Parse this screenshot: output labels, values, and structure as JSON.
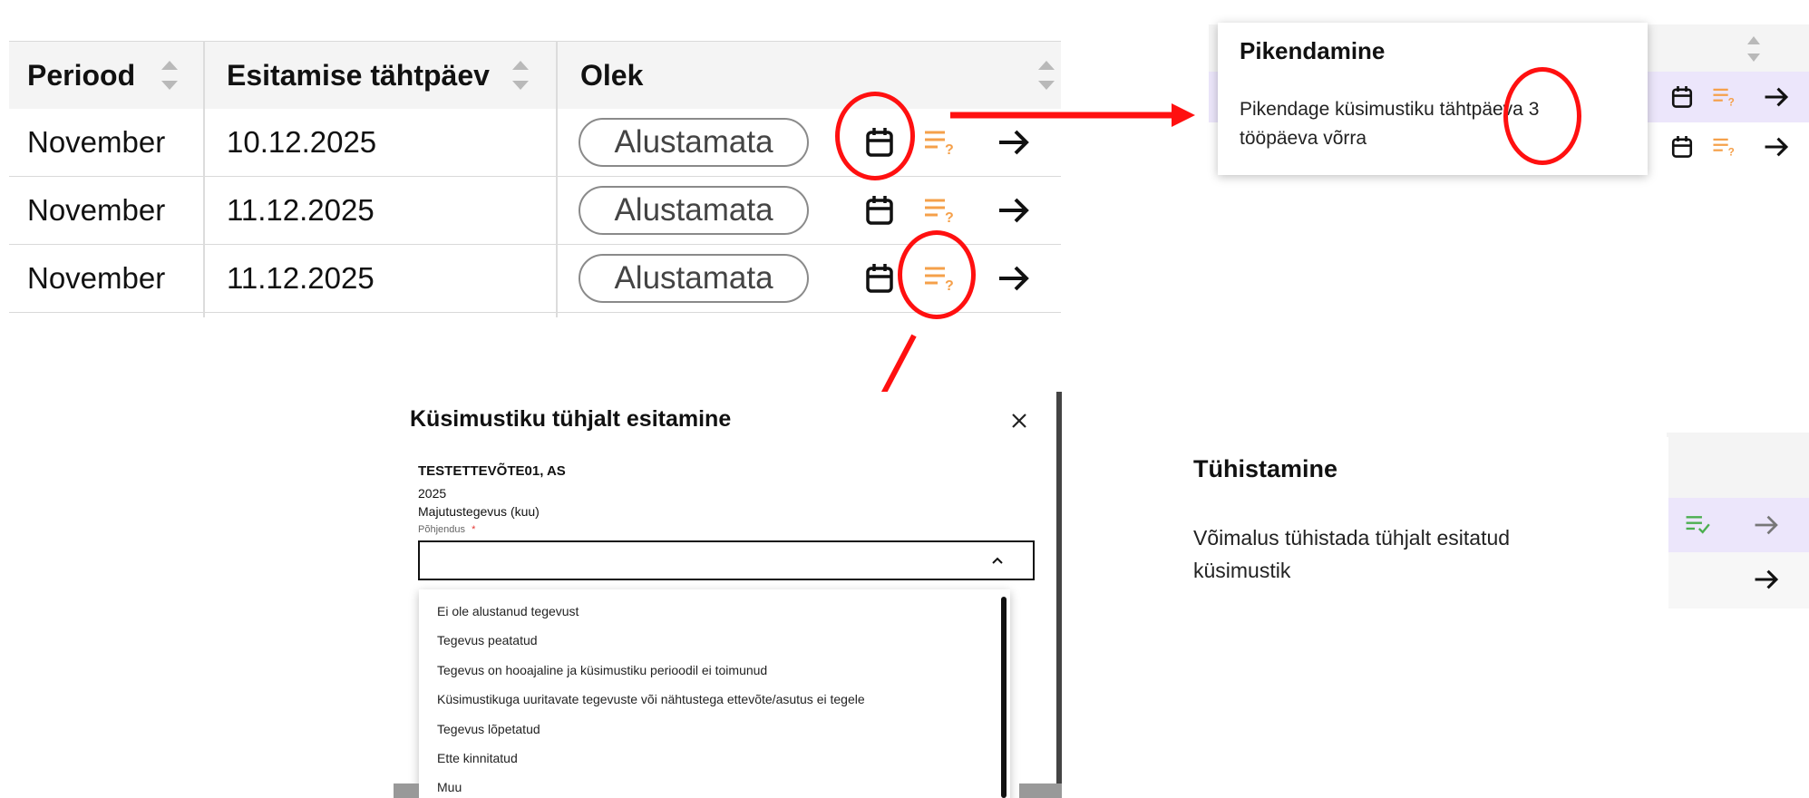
{
  "table": {
    "columns": [
      "Periood",
      "Esitamise tähtpäev",
      "Olek"
    ],
    "rows": [
      {
        "period": "November",
        "due_date": "10.12.2025",
        "status": "Alustamata"
      },
      {
        "period": "November",
        "due_date": "11.12.2025",
        "status": "Alustamata"
      },
      {
        "period": "November",
        "due_date": "11.12.2025",
        "status": "Alustamata"
      }
    ]
  },
  "tooltip_extend": {
    "title": "Pikendamine",
    "text_line1": "Pikendage küsimustiku tähtpäeva 3",
    "text_line2": "tööpäeva võrra"
  },
  "tooltip_cancel": {
    "title": "Tühistamine",
    "text_line1": "Võimalus tühistada tühjalt esitatud",
    "text_line2": "küsimustik"
  },
  "dialog": {
    "title": "Küsimustiku tühjalt esitamine",
    "company": "TESTETTEVÕTE01, AS",
    "year": "2025",
    "survey": "Majutustegevus (kuu)",
    "field_label": "Põhjendus",
    "required_mark": "*",
    "options": [
      "Ei ole alustanud tegevust",
      "Tegevus peatatud",
      "Tegevus on hooajaline ja küsimustiku perioodil ei toimunud",
      "Küsimustikuga uuritavate tegevuste või nähtustega ettevõte/asutus ei tegele",
      "Tegevus lõpetatud",
      "Ette kinnitatud",
      "Muu"
    ]
  },
  "colors": {
    "annotation_red": "#ff1010",
    "questionnaire_icon": "#f5a04a",
    "confirmed_icon": "#4caf50",
    "highlight_row": "#ece6fb"
  }
}
